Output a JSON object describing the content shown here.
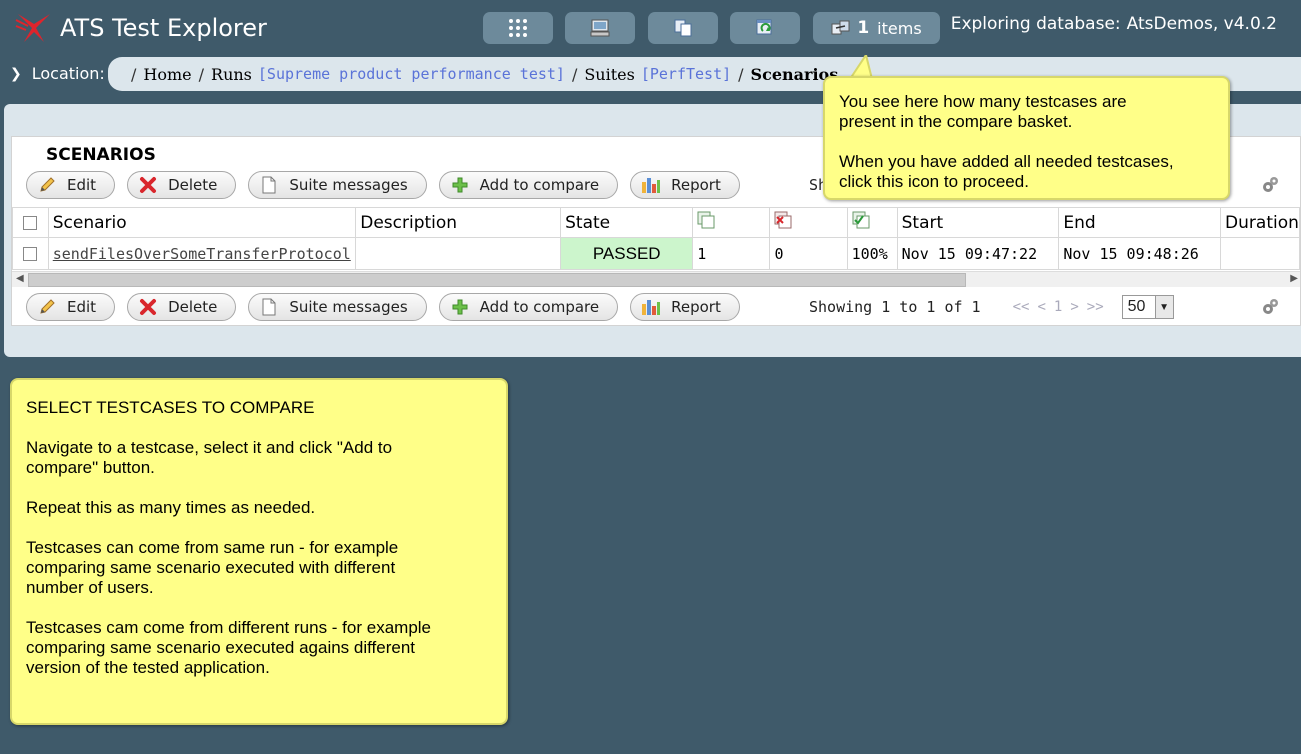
{
  "header": {
    "app_title": "ATS Test Explorer",
    "basket_count": "1",
    "basket_label": "items",
    "db_label": "Exploring database:",
    "db_name": "AtsDemos, v4.0.2"
  },
  "toolbar": {
    "icons": [
      "apps-grid-icon",
      "monitor-icon",
      "copy-pages-icon",
      "refresh-window-icon",
      "compare-basket-icon"
    ]
  },
  "location": {
    "label": "Location:",
    "crumbs": {
      "home": "Home",
      "runs": "Runs",
      "run_name": "[Supreme product performance test]",
      "suites": "Suites",
      "suite_name": "[PerfTest]",
      "current": "Scenarios"
    }
  },
  "grid": {
    "title": "SCENARIOS",
    "buttons": {
      "edit": "Edit",
      "delete": "Delete",
      "suite_messages": "Suite messages",
      "add_to_compare": "Add to compare",
      "report": "Report"
    },
    "columns": [
      "Scenario",
      "Description",
      "State",
      "",
      "",
      "",
      "Start",
      "End",
      "Duration"
    ],
    "rows": [
      {
        "scenario": "sendFilesOverSomeTransferProtocol",
        "description": "",
        "state": "PASSED",
        "total": "1",
        "failed": "0",
        "passed_pct": "100%",
        "start": "Nov 15 09:47:22",
        "end": "Nov 15 09:48:26"
      }
    ],
    "pager": {
      "showing": "Showing 1 to 1 of 1",
      "first": "<<",
      "prev": "<",
      "page": "1",
      "next": ">",
      "last": ">>",
      "page_size": "50"
    },
    "top_pager_partial": "Sh"
  },
  "callouts": {
    "basket_p1": "You see here how many testcases are\npresent in the compare basket.",
    "basket_p2": "When you have added all needed testcases,\nclick this icon to proceed.",
    "select_title": "SELECT TESTCASES TO COMPARE",
    "select_p1": "Navigate to a testcase, select it and click \"Add to\ncompare\" button.",
    "select_p2": "Repeat this as many times as needed.",
    "select_p3": "Testcases can come from same run - for example\ncomparing same scenario executed with different\nnumber of users.",
    "select_p4": "Testcases cam come from different runs - for example\ncomparing same scenario executed agains different\nversion of the tested application."
  },
  "colors": {
    "background": "#3f5a6a",
    "panel": "#dce6ec",
    "toolbar_button": "#6d8a9b",
    "passed": "#ccf5cc",
    "callout": "#ffff88",
    "link": "#5a73d8",
    "logo": "#e0242c"
  }
}
